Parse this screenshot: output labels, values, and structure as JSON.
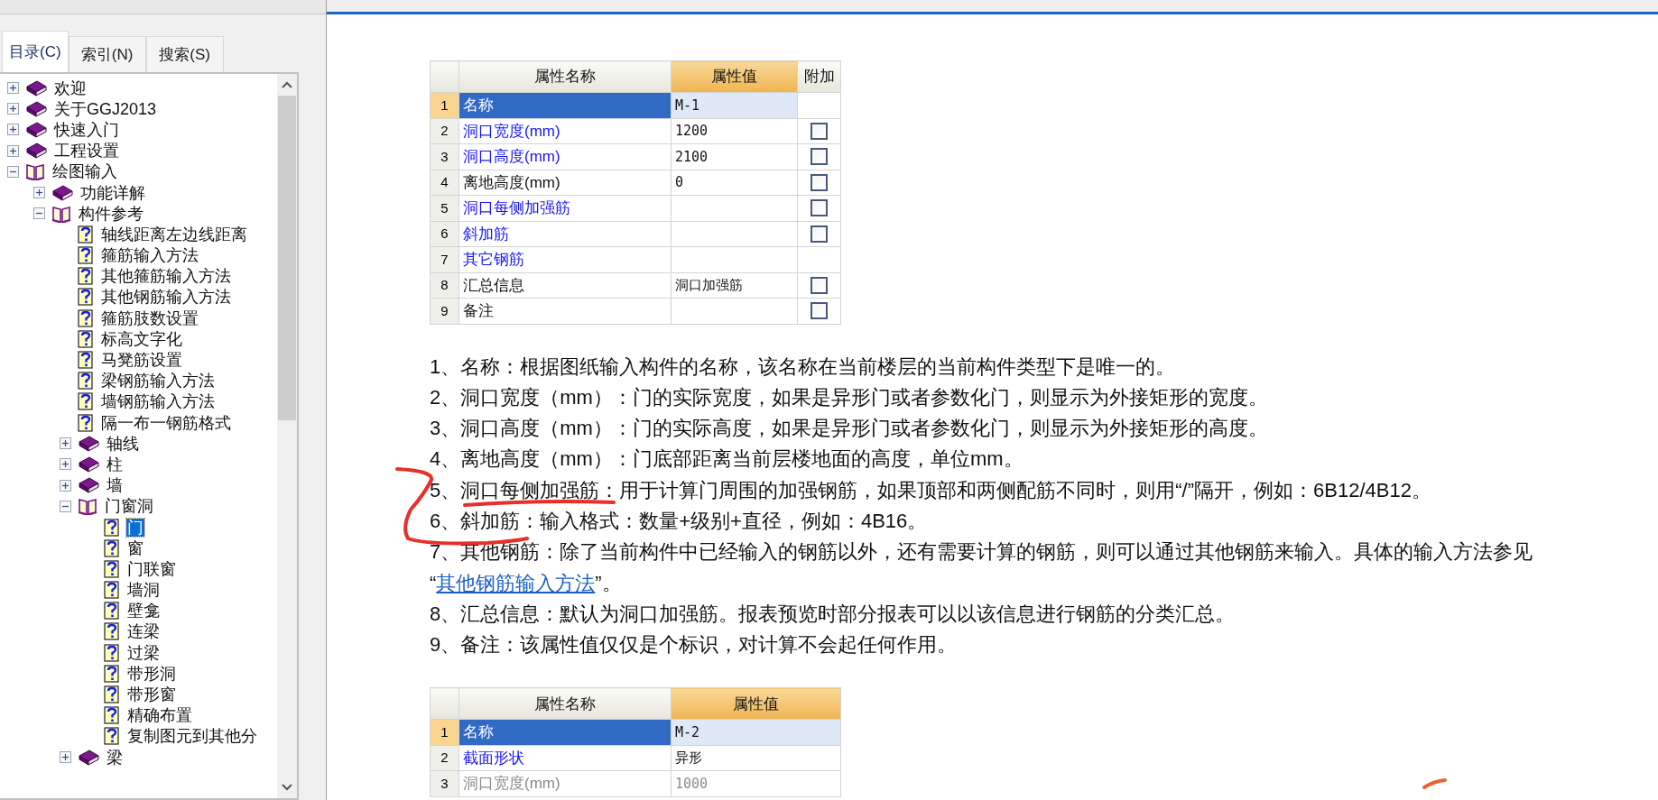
{
  "tabs": [
    {
      "label": "目录(C)",
      "selected": true
    },
    {
      "label": "索引(N)",
      "selected": false
    },
    {
      "label": "搜索(S)",
      "selected": false
    }
  ],
  "tree": [
    {
      "kind": "book",
      "label": "欢迎",
      "expanded": false,
      "selected": false
    },
    {
      "kind": "book",
      "label": "关于GGJ2013",
      "expanded": false,
      "selected": false
    },
    {
      "kind": "book",
      "label": "快速入门",
      "expanded": false,
      "selected": false
    },
    {
      "kind": "book",
      "label": "工程设置",
      "expanded": false,
      "selected": false
    },
    {
      "kind": "book",
      "label": "绘图输入",
      "expanded": true,
      "selected": false,
      "children": [
        {
          "kind": "book",
          "label": "功能详解",
          "expanded": false,
          "selected": false
        },
        {
          "kind": "book",
          "label": "构件参考",
          "expanded": true,
          "selected": false,
          "children": [
            {
              "kind": "topic",
              "label": "轴线距离左边线距离",
              "selected": false
            },
            {
              "kind": "topic",
              "label": "箍筋输入方法",
              "selected": false
            },
            {
              "kind": "topic",
              "label": "其他箍筋输入方法",
              "selected": false
            },
            {
              "kind": "topic",
              "label": "其他钢筋输入方法",
              "selected": false
            },
            {
              "kind": "topic",
              "label": "箍筋肢数设置",
              "selected": false
            },
            {
              "kind": "topic",
              "label": "标高文字化",
              "selected": false
            },
            {
              "kind": "topic",
              "label": "马凳筋设置",
              "selected": false
            },
            {
              "kind": "topic",
              "label": "梁钢筋输入方法",
              "selected": false
            },
            {
              "kind": "topic",
              "label": "墙钢筋输入方法",
              "selected": false
            },
            {
              "kind": "topic",
              "label": "隔一布一钢筋格式",
              "selected": false
            },
            {
              "kind": "book",
              "label": "轴线",
              "expanded": false,
              "selected": false
            },
            {
              "kind": "book",
              "label": "柱",
              "expanded": false,
              "selected": false
            },
            {
              "kind": "book",
              "label": "墙",
              "expanded": false,
              "selected": false
            },
            {
              "kind": "book",
              "label": "门窗洞",
              "expanded": true,
              "selected": false,
              "children": [
                {
                  "kind": "topic",
                  "label": "门",
                  "selected": true
                },
                {
                  "kind": "topic",
                  "label": "窗",
                  "selected": false
                },
                {
                  "kind": "topic",
                  "label": "门联窗",
                  "selected": false
                },
                {
                  "kind": "topic",
                  "label": "墙洞",
                  "selected": false
                },
                {
                  "kind": "topic",
                  "label": "壁龛",
                  "selected": false
                },
                {
                  "kind": "topic",
                  "label": "连梁",
                  "selected": false
                },
                {
                  "kind": "topic",
                  "label": "过梁",
                  "selected": false
                },
                {
                  "kind": "topic",
                  "label": "带形洞",
                  "selected": false
                },
                {
                  "kind": "topic",
                  "label": "带形窗",
                  "selected": false
                },
                {
                  "kind": "topic",
                  "label": "精确布置",
                  "selected": false
                },
                {
                  "kind": "topic",
                  "label": "复制图元到其他分",
                  "selected": false
                }
              ]
            },
            {
              "kind": "book",
              "label": "梁",
              "expanded": false,
              "selected": false
            }
          ]
        }
      ]
    }
  ],
  "table_1": {
    "columns": [
      "属性名称",
      "属性值",
      "附加"
    ],
    "rows": [
      {
        "number": "1",
        "name": "名称",
        "value": "M-1",
        "kind": "link",
        "selected": true
      },
      {
        "number": "2",
        "name": "洞口宽度(mm)",
        "value": "1200",
        "kind": "link",
        "selected": false,
        "checked": false
      },
      {
        "number": "3",
        "name": "洞口高度(mm)",
        "value": "2100",
        "kind": "link",
        "selected": false,
        "checked": false
      },
      {
        "number": "4",
        "name": "离地高度(mm)",
        "value": "0",
        "kind": "plain",
        "selected": false,
        "checked": false
      },
      {
        "number": "5",
        "name": "洞口每侧加强筋",
        "value": "",
        "kind": "link",
        "selected": false,
        "checked": false
      },
      {
        "number": "6",
        "name": "斜加筋",
        "value": "",
        "kind": "link",
        "selected": false,
        "checked": false
      },
      {
        "number": "7",
        "name": "其它钢筋",
        "value": "",
        "kind": "link",
        "selected": false
      },
      {
        "number": "8",
        "name": "汇总信息",
        "value": "洞口加强筋",
        "kind": "plain",
        "selected": false,
        "checked": false
      },
      {
        "number": "9",
        "name": "备注",
        "value": "",
        "kind": "plain",
        "selected": false,
        "checked": false
      }
    ]
  },
  "notes": [
    {
      "parts": [
        {
          "kind": "text",
          "text": "1、名称：根据图纸输入构件的名称，该名称在当前楼层的当前构件类型下是唯一的。"
        }
      ]
    },
    {
      "parts": [
        {
          "kind": "text",
          "text": "2、洞口宽度（mm）：门的实际宽度，如果是异形门或者参数化门，则显示为外接矩形的宽度。"
        }
      ]
    },
    {
      "parts": [
        {
          "kind": "text",
          "text": "3、洞口高度（mm）：门的实际高度，如果是异形门或者参数化门，则显示为外接矩形的高度。"
        }
      ]
    },
    {
      "parts": [
        {
          "kind": "text",
          "text": "4、离地高度（mm）：门底部距离当前层楼地面的高度，单位mm。"
        }
      ]
    },
    {
      "parts": [
        {
          "kind": "text",
          "text": "5、洞口每侧加强筋：用于计算门周围的加强钢筋，如果顶部和两侧配筋不同时，则用“/”隔开，例如：6B12/4B12。"
        }
      ]
    },
    {
      "parts": [
        {
          "kind": "text",
          "text": "6、斜加筋：输入格式：数量+级别+直径，例如：4B16。"
        }
      ]
    },
    {
      "parts": [
        {
          "kind": "text",
          "text": "7、其他钢筋：除了当前构件中已经输入的钢筋以外，还有需要计算的钢筋，则可以通过其他钢筋来输入。具体的输入方法参见"
        },
        {
          "kind": "break"
        },
        {
          "kind": "text",
          "text": "“"
        },
        {
          "kind": "link",
          "text": "其他钢筋输入方法"
        },
        {
          "kind": "text",
          "text": "”。"
        }
      ]
    },
    {
      "parts": [
        {
          "kind": "text",
          "text": "8、汇总信息：默认为洞口加强筋。报表预览时部分报表可以以该信息进行钢筋的分类汇总。"
        }
      ]
    },
    {
      "parts": [
        {
          "kind": "text",
          "text": "9、备注：该属性值仅仅是个标识，对计算不会起任何作用。"
        }
      ]
    }
  ],
  "table_2": {
    "columns": [
      "属性名称",
      "属性值"
    ],
    "rows": [
      {
        "number": "1",
        "name": "名称",
        "value": "M-2",
        "kind": "link",
        "selected": true
      },
      {
        "number": "2",
        "name": "截面形状",
        "value": "异形",
        "kind": "link",
        "selected": false
      },
      {
        "number": "3",
        "name": "洞口宽度(mm)",
        "value": "1000",
        "kind": "disabled",
        "selected": false
      }
    ]
  }
}
